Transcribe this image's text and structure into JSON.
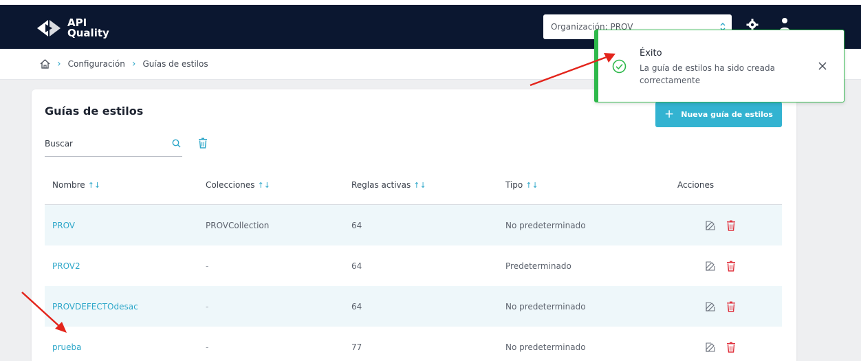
{
  "app": {
    "logo_line1": "API",
    "logo_line2": "Quality"
  },
  "navbar": {
    "org_select_value": "Organización: PROV",
    "settings_icon": "gear-icon",
    "user_icon": "user-icon"
  },
  "breadcrumb": {
    "home_icon": "home-icon",
    "items": [
      "Configuración",
      "Guías de estilos"
    ]
  },
  "page": {
    "title": "Guías de estilos",
    "new_button_label": "Nueva guía de estilos",
    "search_placeholder": "Buscar"
  },
  "table": {
    "columns": [
      "Nombre",
      "Colecciones",
      "Reglas activas",
      "Tipo",
      "Acciones"
    ],
    "rows": [
      {
        "name": "PROV",
        "collections": "PROVCollection",
        "rules": "64",
        "type": "No predeterminado"
      },
      {
        "name": "PROV2",
        "collections": "-",
        "rules": "64",
        "type": "Predeterminado"
      },
      {
        "name": "PROVDEFECTOdesac",
        "collections": "-",
        "rules": "64",
        "type": "No predeterminado"
      },
      {
        "name": "prueba",
        "collections": "-",
        "rules": "77",
        "type": "No predeterminado"
      }
    ]
  },
  "toast": {
    "title": "Éxito",
    "message": "La guía de estilos ha sido creada correctamente"
  },
  "colors": {
    "navbar": "#0b1730",
    "accent": "#33b3d1",
    "success": "#2db84a",
    "danger": "#e0333f",
    "annotation": "#e3241b"
  }
}
